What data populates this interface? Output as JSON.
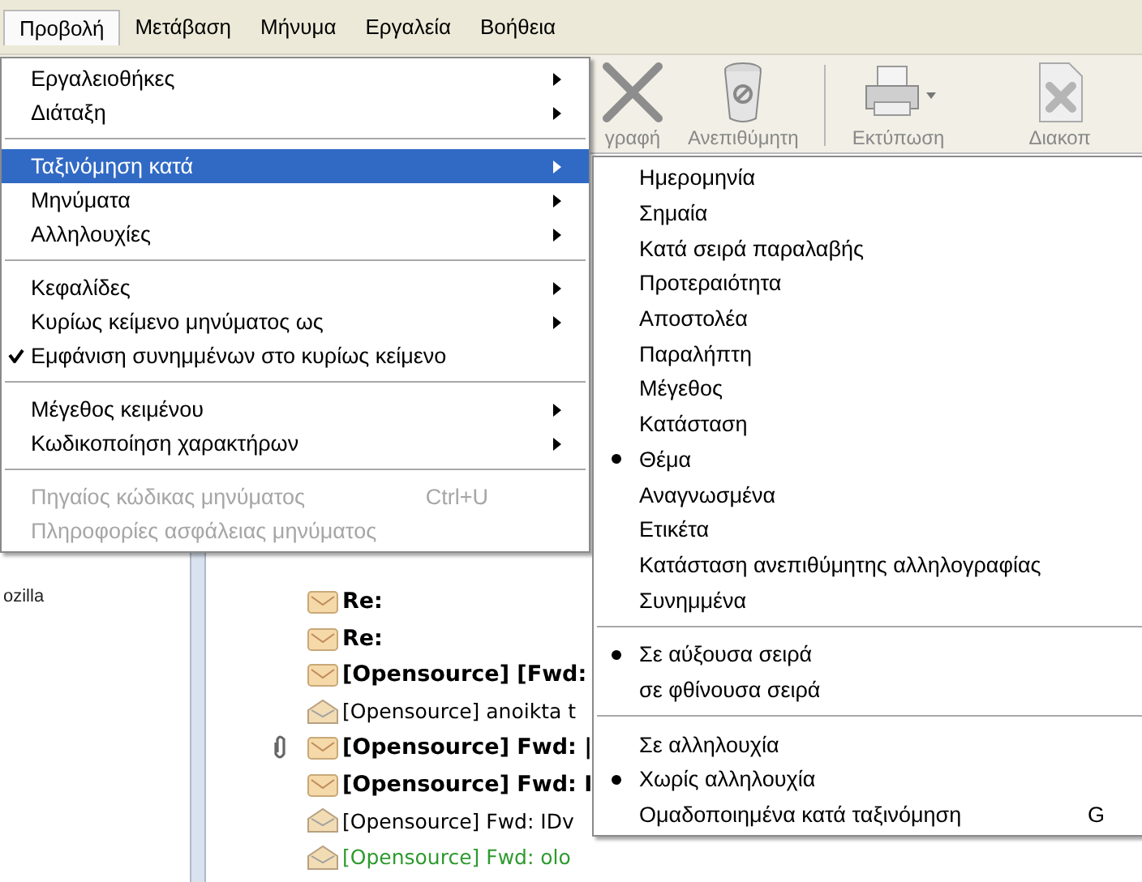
{
  "menubar": [
    {
      "label": "Προβολή",
      "selected": true
    },
    {
      "label": "Μετάβαση",
      "selected": false
    },
    {
      "label": "Μήνυμα",
      "selected": false
    },
    {
      "label": "Εργαλεία",
      "selected": false
    },
    {
      "label": "Βοήθεια",
      "selected": false
    }
  ],
  "toolbar": [
    {
      "kind": "delete",
      "label": "γραφή"
    },
    {
      "kind": "junk",
      "label": "Ανεπιθύμητη"
    },
    {
      "kind": "separator"
    },
    {
      "kind": "print",
      "label": "Εκτύπωση"
    },
    {
      "kind": "stop",
      "label": "Διακοπ"
    }
  ],
  "menu": [
    {
      "kind": "submenu",
      "label": "Εργαλειοθήκες",
      "selected": false,
      "checked": false,
      "disabled": false
    },
    {
      "kind": "submenu",
      "label": "Διάταξη",
      "selected": false,
      "checked": false,
      "disabled": false
    },
    {
      "kind": "separator"
    },
    {
      "kind": "submenu",
      "label": "Ταξινόμηση κατά",
      "selected": true,
      "checked": false,
      "disabled": false
    },
    {
      "kind": "submenu",
      "label": "Μηνύματα",
      "selected": false,
      "checked": false,
      "disabled": false
    },
    {
      "kind": "submenu",
      "label": "Αλληλουχίες",
      "selected": false,
      "checked": false,
      "disabled": false
    },
    {
      "kind": "separator"
    },
    {
      "kind": "submenu",
      "label": "Κεφαλίδες",
      "selected": false,
      "checked": false,
      "disabled": false
    },
    {
      "kind": "submenu",
      "label": "Κυρίως κείμενο μηνύματος ως",
      "selected": false,
      "checked": false,
      "disabled": false
    },
    {
      "kind": "item",
      "label": "Εμφάνιση συνημμένων στο κυρίως κείμενο",
      "selected": false,
      "checked": true,
      "disabled": false
    },
    {
      "kind": "separator"
    },
    {
      "kind": "submenu",
      "label": "Μέγεθος κειμένου",
      "selected": false,
      "checked": false,
      "disabled": false
    },
    {
      "kind": "submenu",
      "label": "Κωδικοποίηση χαρακτήρων",
      "selected": false,
      "checked": false,
      "disabled": false
    },
    {
      "kind": "separator"
    },
    {
      "kind": "item",
      "label": "Πηγαίος κώδικας μηνύματος",
      "shortcut": "Ctrl+U",
      "selected": false,
      "checked": false,
      "disabled": true
    },
    {
      "kind": "item",
      "label": "Πληροφορίες ασφάλειας μηνύματος",
      "selected": false,
      "checked": false,
      "disabled": true
    }
  ],
  "submenu": [
    {
      "kind": "item",
      "label": "Ημερομηνία",
      "selected": false
    },
    {
      "kind": "item",
      "label": "Σημαία",
      "selected": false
    },
    {
      "kind": "item",
      "label": "Κατά σειρά παραλαβής",
      "selected": false
    },
    {
      "kind": "item",
      "label": "Προτεραιότητα",
      "selected": false
    },
    {
      "kind": "item",
      "label": "Αποστολέα",
      "selected": false
    },
    {
      "kind": "item",
      "label": "Παραλήπτη",
      "selected": false
    },
    {
      "kind": "item",
      "label": "Μέγεθος",
      "selected": false
    },
    {
      "kind": "item",
      "label": "Κατάσταση",
      "selected": false
    },
    {
      "kind": "item",
      "label": "Θέμα",
      "selected": true
    },
    {
      "kind": "item",
      "label": "Αναγνωσμένα",
      "selected": false
    },
    {
      "kind": "item",
      "label": "Ετικέτα",
      "selected": false
    },
    {
      "kind": "item",
      "label": "Κατάσταση ανεπιθύμητης αλληλογραφίας",
      "selected": false
    },
    {
      "kind": "item",
      "label": "Συνημμένα",
      "selected": false
    },
    {
      "kind": "separator"
    },
    {
      "kind": "item",
      "label": "Σε αύξουσα σειρά",
      "selected": true
    },
    {
      "kind": "item",
      "label": "σε φθίνουσα σειρά",
      "selected": false
    },
    {
      "kind": "separator"
    },
    {
      "kind": "item",
      "label": "Σε αλληλουχία",
      "selected": false
    },
    {
      "kind": "item",
      "label": "Χωρίς αλληλουχία",
      "selected": true
    },
    {
      "kind": "item",
      "label": "Ομαδοποιημένα κατά ταξινόμηση",
      "shortcut": "G",
      "selected": false
    }
  ],
  "folder_pane": {
    "item": "ozilla"
  },
  "messages": [
    {
      "subject": "Re:",
      "unread": true,
      "attachment": false,
      "color": "#000000"
    },
    {
      "subject": "Re:",
      "unread": true,
      "attachment": false,
      "color": "#000000"
    },
    {
      "subject": "[Opensource] [Fwd:",
      "unread": true,
      "attachment": false,
      "color": "#000000"
    },
    {
      "subject": "[Opensource] anoikta t",
      "unread": false,
      "attachment": false,
      "color": "#000000"
    },
    {
      "subject": "[Opensource] Fwd: |",
      "unread": true,
      "attachment": true,
      "color": "#000000"
    },
    {
      "subject": "[Opensource] Fwd: I",
      "unread": true,
      "attachment": false,
      "color": "#000000"
    },
    {
      "subject": "[Opensource] Fwd: IDv",
      "unread": false,
      "attachment": false,
      "color": "#000000"
    },
    {
      "subject": "[Opensource] Fwd: olo",
      "unread": false,
      "attachment": false,
      "color": "#2e9a2e"
    }
  ]
}
